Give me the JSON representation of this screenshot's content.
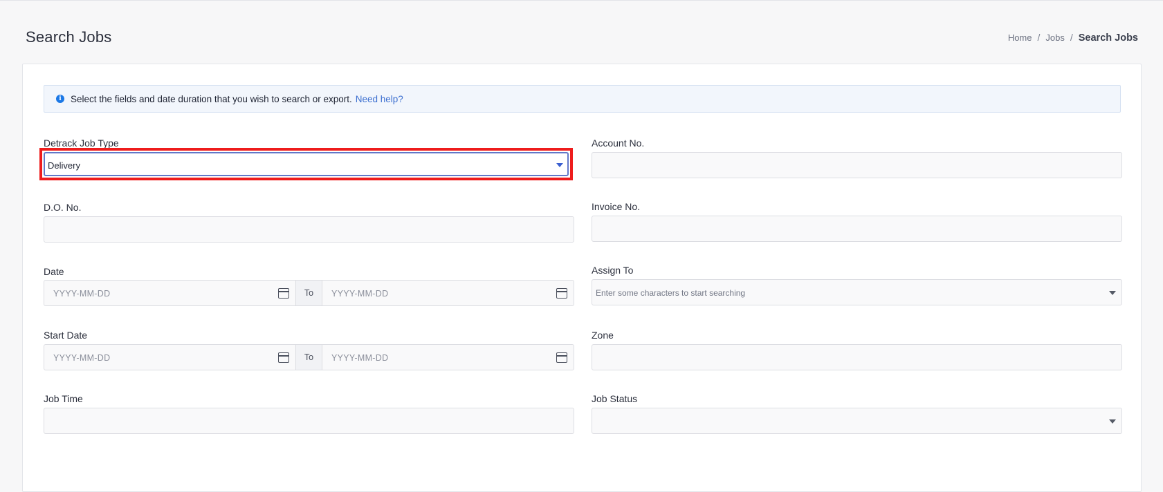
{
  "header": {
    "title": "Search Jobs",
    "breadcrumb": [
      "Home",
      "Jobs",
      "Search Jobs"
    ],
    "separator": "/"
  },
  "alert": {
    "icon": "info-icon",
    "message": "Select the fields and date duration that you wish to search or export.",
    "link": "Need help?"
  },
  "form": {
    "job_type": {
      "label": "Detrack Job Type",
      "value": "Delivery"
    },
    "account_no": {
      "label": "Account No.",
      "value": ""
    },
    "do_no": {
      "label": "D.O. No.",
      "value": ""
    },
    "invoice_no": {
      "label": "Invoice No.",
      "value": ""
    },
    "date": {
      "label": "Date",
      "from_placeholder": "YYYY-MM-DD",
      "to_label": "To",
      "to_placeholder": "YYYY-MM-DD"
    },
    "assign_to": {
      "label": "Assign To",
      "placeholder": "Enter some characters to start searching"
    },
    "start_date": {
      "label": "Start Date",
      "from_placeholder": "YYYY-MM-DD",
      "to_label": "To",
      "to_placeholder": "YYYY-MM-DD"
    },
    "zone": {
      "label": "Zone",
      "value": ""
    },
    "job_time": {
      "label": "Job Time",
      "value": ""
    },
    "job_status": {
      "label": "Job Status",
      "value": ""
    }
  },
  "colors": {
    "accent": "#3c6fd0",
    "highlight": "#ee1c1c",
    "info": "#1b78e6"
  }
}
